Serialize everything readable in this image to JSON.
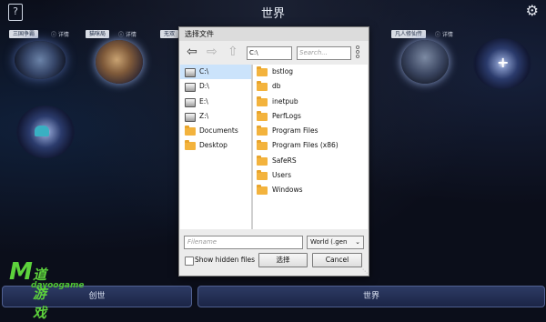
{
  "app": {
    "title": "世界",
    "help_icon": "?",
    "settings_icon": "gear-icon"
  },
  "worlds": [
    {
      "tag": "三国争霸",
      "detail": "详情"
    },
    {
      "tag": "猫咪局",
      "detail": "详情"
    },
    {
      "tag": "无双",
      "detail": ""
    },
    {
      "tag": "凡人修仙传",
      "detail": "详情"
    }
  ],
  "create_label": "+",
  "bottom": {
    "left_label": "创世",
    "right_label": "世界"
  },
  "watermark": {
    "m": "M",
    "cn": "道游戏",
    "en": "dayoogame"
  },
  "dialog": {
    "title": "选择文件",
    "path_value": "C:\\",
    "search_placeholder": "Search...",
    "drives": [
      {
        "label": "C:\\",
        "selected": true
      },
      {
        "label": "D:\\"
      },
      {
        "label": "E:\\"
      },
      {
        "label": "Z:\\"
      },
      {
        "label": "Documents",
        "type": "folder"
      },
      {
        "label": "Desktop",
        "type": "folder"
      }
    ],
    "folders": [
      "bstlog",
      "db",
      "inetpub",
      "PerfLogs",
      "Program Files",
      "Program Files (x86)",
      "SafeRS",
      "Users",
      "Windows"
    ],
    "filename_placeholder": "Filename",
    "filetype_value": "World (.gen",
    "show_hidden_label": "Show hidden files",
    "confirm_label": "选择",
    "cancel_label": "Cancel"
  }
}
